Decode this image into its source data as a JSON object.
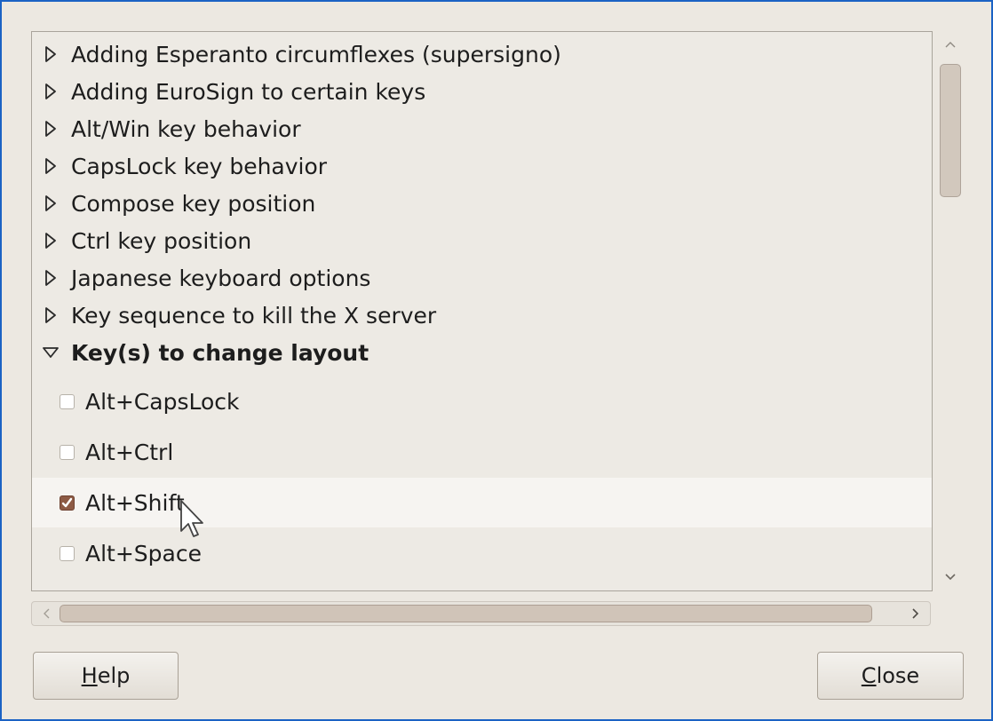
{
  "groups": [
    {
      "label": "Adding Esperanto circumflexes (supersigno)",
      "expanded": false
    },
    {
      "label": "Adding EuroSign to certain keys",
      "expanded": false
    },
    {
      "label": "Alt/Win key behavior",
      "expanded": false
    },
    {
      "label": "CapsLock key behavior",
      "expanded": false
    },
    {
      "label": "Compose key position",
      "expanded": false
    },
    {
      "label": "Ctrl key position",
      "expanded": false
    },
    {
      "label": "Japanese keyboard options",
      "expanded": false
    },
    {
      "label": "Key sequence to kill the X server",
      "expanded": false
    },
    {
      "label": "Key(s) to change layout",
      "expanded": true
    }
  ],
  "options": [
    {
      "label": "Alt+CapsLock",
      "checked": false
    },
    {
      "label": "Alt+Ctrl",
      "checked": false
    },
    {
      "label": "Alt+Shift",
      "checked": true
    },
    {
      "label": "Alt+Space",
      "checked": false
    }
  ],
  "buttons": {
    "help": {
      "mnemonic": "H",
      "rest": "elp"
    },
    "close": {
      "mnemonic": "C",
      "rest": "lose"
    }
  },
  "icons": {
    "collapsed": "triangle-right-icon",
    "expanded": "triangle-down-icon",
    "check": "checkmark-icon",
    "cursor": "mouse-pointer-icon"
  },
  "colors": {
    "window_border": "#1b62c4",
    "background": "#ece8e1",
    "checkbox_checked": "#8d5a44"
  }
}
